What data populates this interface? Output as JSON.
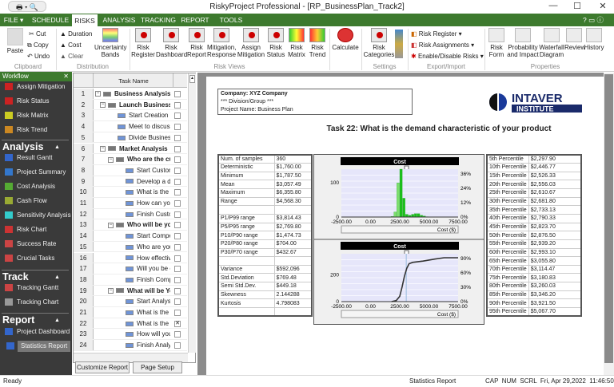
{
  "window": {
    "title": "RiskyProject Professional - [RP_BusinessPlan_Track2]",
    "minimize": "—",
    "maximize": "☐",
    "close": "✕"
  },
  "tabs": [
    "FILE ▾",
    "SCHEDULE",
    "RISKS",
    "ANALYSIS",
    "TRACKING",
    "REPORT",
    "TOOLS"
  ],
  "ribbon": {
    "clipboard": {
      "paste": "Paste",
      "cut": "Cut",
      "copy": "Copy",
      "undo": "Undo",
      "group": "Clipboard"
    },
    "distribution": {
      "duration": "Duration",
      "cost": "Cost",
      "clear": "Clear",
      "bands": "Uncertainty Bands",
      "group": "Distribution"
    },
    "risk_views": {
      "items": [
        "Risk Register",
        "Risk Dashboard",
        "Risk Report",
        "Mitigation, Response",
        "Assign Mitigation",
        "Risk Status",
        "Risk Matrix",
        "Risk Trend"
      ],
      "group": "Risk Views"
    },
    "calculate": "Calculate",
    "settings": {
      "categories": "Risk Categories",
      "group": "Settings"
    },
    "export": {
      "items": [
        "Risk Register ▾",
        "Risk Assignments ▾",
        "Enable/Disable Risks ▾"
      ],
      "group": "Export/Import"
    },
    "properties": {
      "items": [
        "Risk Form",
        "Probability and Impact",
        "Waterfall Diagram",
        "Review",
        "History"
      ],
      "group": "Properties"
    }
  },
  "sidebar": {
    "title": "Workflow",
    "risk_items": [
      "Assign Mitigation",
      "Risk Status",
      "Risk Matrix",
      "Risk Trend"
    ],
    "analysis": {
      "title": "Analysis",
      "items": [
        "Result Gantt",
        "Project Summary",
        "Cost Analysis",
        "Cash Flow",
        "Sensitivity Analysis",
        "Risk Chart",
        "Success Rate",
        "Crucial Tasks"
      ]
    },
    "track": {
      "title": "Track",
      "items": [
        "Tracking Gantt",
        "Tracking Chart"
      ]
    },
    "report": {
      "title": "Report",
      "items": [
        "Project Dashboard",
        "Statistics Report"
      ]
    }
  },
  "grid": {
    "header": "Task Name",
    "rows": [
      {
        "n": "1",
        "name": "Business Analysis",
        "lvl": 0,
        "sum": true
      },
      {
        "n": "2",
        "name": "Launch Business",
        "lvl": 1,
        "sum": true
      },
      {
        "n": "3",
        "name": "Start Creation of",
        "lvl": 2
      },
      {
        "n": "4",
        "name": "Meet to discuss",
        "lvl": 2
      },
      {
        "n": "5",
        "name": "Divide Business",
        "lvl": 2
      },
      {
        "n": "6",
        "name": "Market Analysis",
        "lvl": 1,
        "sum": true
      },
      {
        "n": "7",
        "name": "Who are the cu",
        "lvl": 2,
        "sum": true
      },
      {
        "n": "8",
        "name": "Start Custome",
        "lvl": 3
      },
      {
        "n": "9",
        "name": "Develop a de",
        "lvl": 3
      },
      {
        "n": "10",
        "name": "What is the p",
        "lvl": 3
      },
      {
        "n": "11",
        "name": "How can you",
        "lvl": 3
      },
      {
        "n": "12",
        "name": "Finish Custon",
        "lvl": 3
      },
      {
        "n": "13",
        "name": "Who will be yo",
        "lvl": 2,
        "sum": true
      },
      {
        "n": "14",
        "name": "Start Competi",
        "lvl": 3
      },
      {
        "n": "15",
        "name": "Who are your",
        "lvl": 3
      },
      {
        "n": "16",
        "name": "How effectiv",
        "lvl": 3
      },
      {
        "n": "17",
        "name": "Will you be co",
        "lvl": 3
      },
      {
        "n": "18",
        "name": "Finish Compe",
        "lvl": 3
      },
      {
        "n": "19",
        "name": "What will be Yo",
        "lvl": 2,
        "sum": true
      },
      {
        "n": "20",
        "name": "Start Analysis",
        "lvl": 3
      },
      {
        "n": "21",
        "name": "What is the d",
        "lvl": 3
      },
      {
        "n": "22",
        "name": "What is the d",
        "lvl": 3,
        "checked": true
      },
      {
        "n": "23",
        "name": "How will you",
        "lvl": 3
      },
      {
        "n": "24",
        "name": "Finish Analys",
        "lvl": 3
      }
    ],
    "buttons": [
      "Customize Report",
      "Page Setup"
    ]
  },
  "report": {
    "company": "Company: XYZ Company",
    "division": "*** Division/Group ***",
    "project": "Project Name: Business Plan",
    "logo": "INTAVER INSTITUTE",
    "title": "Task 22: What is the demand characteristic of your product",
    "stats": [
      [
        "Num. of samples",
        "360"
      ],
      [
        "Deterministic",
        "$1,760.00"
      ],
      [
        "Minimum",
        "$1,787.50"
      ],
      [
        "Mean",
        "$3,057.49"
      ],
      [
        "Maximum",
        "$6,355.80"
      ],
      [
        "Range",
        "$4,568.30"
      ],
      [
        "",
        ""
      ],
      [
        "P1/P99 range",
        "$3,814.43"
      ],
      [
        "P5/P95 range",
        "$2,769.80"
      ],
      [
        "P10/P90 range",
        "$1,474.73"
      ],
      [
        "P20/P80 range",
        "$704.00"
      ],
      [
        "P30/P70 range",
        "$432.67"
      ],
      [
        "",
        ""
      ],
      [
        "Variance",
        "$592,096"
      ],
      [
        "Std.Deviation",
        "$769.48"
      ],
      [
        "Semi Std.Dev.",
        "$449.18"
      ],
      [
        "Skewness",
        "2.144288"
      ],
      [
        "Kurtosis",
        "4.798083"
      ],
      [
        "",
        ""
      ]
    ],
    "percentiles": [
      [
        "5th Percentile",
        "$2,297.90"
      ],
      [
        "10th Percentile",
        "$2,446.77"
      ],
      [
        "15th Percentile",
        "$2,526.33"
      ],
      [
        "20th Percentile",
        "$2,556.03"
      ],
      [
        "25th Percentile",
        "$2,610.67"
      ],
      [
        "30th Percentile",
        "$2,681.80"
      ],
      [
        "35th Percentile",
        "$2,733.13"
      ],
      [
        "40th Percentile",
        "$2,790.33"
      ],
      [
        "45th Percentile",
        "$2,823.70"
      ],
      [
        "50th Percentile",
        "$2,876.50"
      ],
      [
        "55th Percentile",
        "$2,939.20"
      ],
      [
        "60th Percentile",
        "$2,993.10"
      ],
      [
        "65th Percentile",
        "$3,055.80"
      ],
      [
        "70th Percentile",
        "$3,114.47"
      ],
      [
        "75th Percentile",
        "$3,180.83"
      ],
      [
        "80th Percentile",
        "$3,260.03"
      ],
      [
        "85th Percentile",
        "$3,346.20"
      ],
      [
        "90th Percentile",
        "$3,921.50"
      ],
      [
        "95th Percentile",
        "$5,067.70"
      ]
    ]
  },
  "chart_data": [
    {
      "type": "bar",
      "title": "Cost",
      "xlabel": "Cost ($)",
      "xlim": [
        -2500,
        7500
      ],
      "ylim": [
        0,
        140
      ],
      "y2lim": [
        0,
        40
      ],
      "xticks": [
        "-2500.00",
        "0.00",
        "2500.00",
        "5000.00",
        "7500.00"
      ],
      "yticks": [
        "0",
        "100"
      ],
      "y2ticks": [
        "0%",
        "12%",
        "24%",
        "36%"
      ],
      "bin_start": 1750,
      "bin_width": 250,
      "values": [
        2,
        15,
        100,
        140,
        55,
        8,
        5,
        8,
        10,
        10,
        5,
        3,
        1
      ]
    },
    {
      "type": "line",
      "title": "Cost",
      "xlabel": "Cost ($)",
      "xlim": [
        -2500,
        7500
      ],
      "ylim": [
        0,
        360
      ],
      "y2lim": [
        0,
        100
      ],
      "xticks": [
        "-2500.00",
        "0.00",
        "2500.00",
        "5000.00",
        "7500.00"
      ],
      "yticks": [
        "0",
        "200"
      ],
      "y2ticks": [
        "0%",
        "30%",
        "60%",
        "90%"
      ],
      "x": [
        1800,
        2200,
        2500,
        2700,
        2900,
        3100,
        3300,
        3600,
        4500,
        5500,
        6300,
        7500
      ],
      "y": [
        0,
        8,
        40,
        110,
        190,
        250,
        285,
        295,
        305,
        320,
        330,
        330
      ]
    }
  ],
  "status": {
    "left": "Ready",
    "center": "Statistics Report",
    "indicators": "CAP  NUM  SCRL  Fri, Apr 29,2022  11:46:50 AM"
  }
}
